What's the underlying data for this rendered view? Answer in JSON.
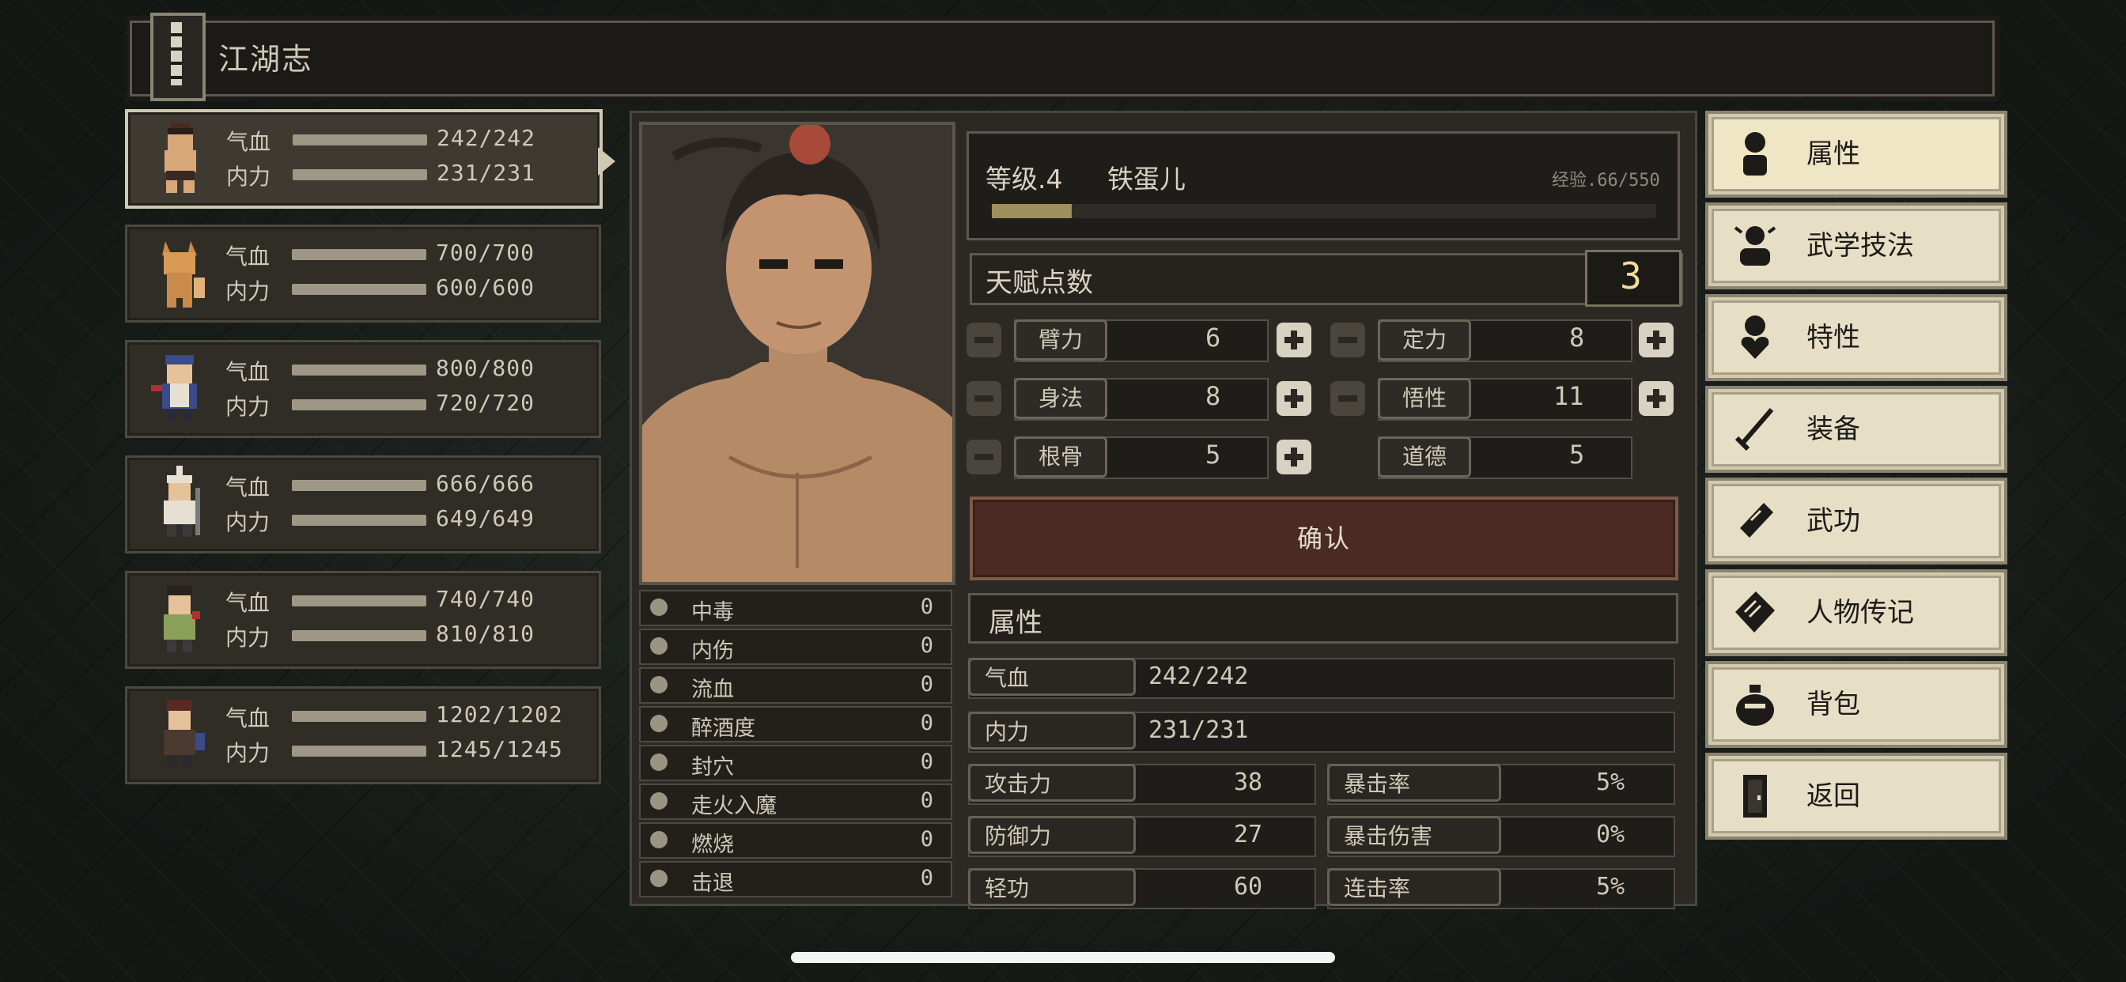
{
  "header": {
    "title": "江湖志"
  },
  "party": [
    {
      "hp_label": "气血",
      "mp_label": "内力",
      "hp": "242/242",
      "mp": "231/231",
      "active": true
    },
    {
      "hp_label": "气血",
      "mp_label": "内力",
      "hp": "700/700",
      "mp": "600/600"
    },
    {
      "hp_label": "气血",
      "mp_label": "内力",
      "hp": "800/800",
      "mp": "720/720"
    },
    {
      "hp_label": "气血",
      "mp_label": "内力",
      "hp": "666/666",
      "mp": "649/649"
    },
    {
      "hp_label": "气血",
      "mp_label": "内力",
      "hp": "740/740",
      "mp": "810/810"
    },
    {
      "hp_label": "气血",
      "mp_label": "内力",
      "hp": "1202/1202",
      "mp": "1245/1245"
    }
  ],
  "character": {
    "level": "等级.4",
    "name": "铁蛋儿",
    "exp": "经验.66/550",
    "exp_fraction": 0.12
  },
  "talent": {
    "label": "天赋点数",
    "value": "3"
  },
  "stats": {
    "bili": {
      "label": "臂力",
      "value": "6"
    },
    "dingli": {
      "label": "定力",
      "value": "8"
    },
    "shenfa": {
      "label": "身法",
      "value": "8"
    },
    "wuxing": {
      "label": "悟性",
      "value": "11"
    },
    "gengu": {
      "label": "根骨",
      "value": "5"
    },
    "daode": {
      "label": "道德",
      "value": "5"
    }
  },
  "confirm_label": "确认",
  "ailments": [
    {
      "name": "中毒",
      "value": "0"
    },
    {
      "name": "内伤",
      "value": "0"
    },
    {
      "name": "流血",
      "value": "0"
    },
    {
      "name": "醉酒度",
      "value": "0"
    },
    {
      "name": "封穴",
      "value": "0"
    },
    {
      "name": "走火入魔",
      "value": "0"
    },
    {
      "name": "燃烧",
      "value": "0"
    },
    {
      "name": "击退",
      "value": "0"
    }
  ],
  "attributes": {
    "title": "属性",
    "qixue": {
      "label": "气血",
      "value": "242/242"
    },
    "neili": {
      "label": "内力",
      "value": "231/231"
    },
    "gongji": {
      "label": "攻击力",
      "value": "38"
    },
    "baoji": {
      "label": "暴击率",
      "value": "5%"
    },
    "fangyu": {
      "label": "防御力",
      "value": "27"
    },
    "baoshang": {
      "label": "暴击伤害",
      "value": "0%"
    },
    "qinggong": {
      "label": "轻功",
      "value": "60"
    },
    "lianji": {
      "label": "连击率",
      "value": "5%"
    }
  },
  "menu": [
    {
      "label": "属性",
      "icon": "figure-icon"
    },
    {
      "label": "武学技法",
      "icon": "meditation-icon"
    },
    {
      "label": "特性",
      "icon": "heart-figure-icon"
    },
    {
      "label": "装备",
      "icon": "sword-icon"
    },
    {
      "label": "武功",
      "icon": "scroll-icon"
    },
    {
      "label": "人物传记",
      "icon": "book-icon"
    },
    {
      "label": "背包",
      "icon": "bag-icon"
    },
    {
      "label": "返回",
      "icon": "door-icon"
    }
  ],
  "colors": {
    "accent_gold": "#f0dc9a",
    "menu_bg": "#e6dfc6",
    "confirm_bg": "#4a2a22"
  }
}
